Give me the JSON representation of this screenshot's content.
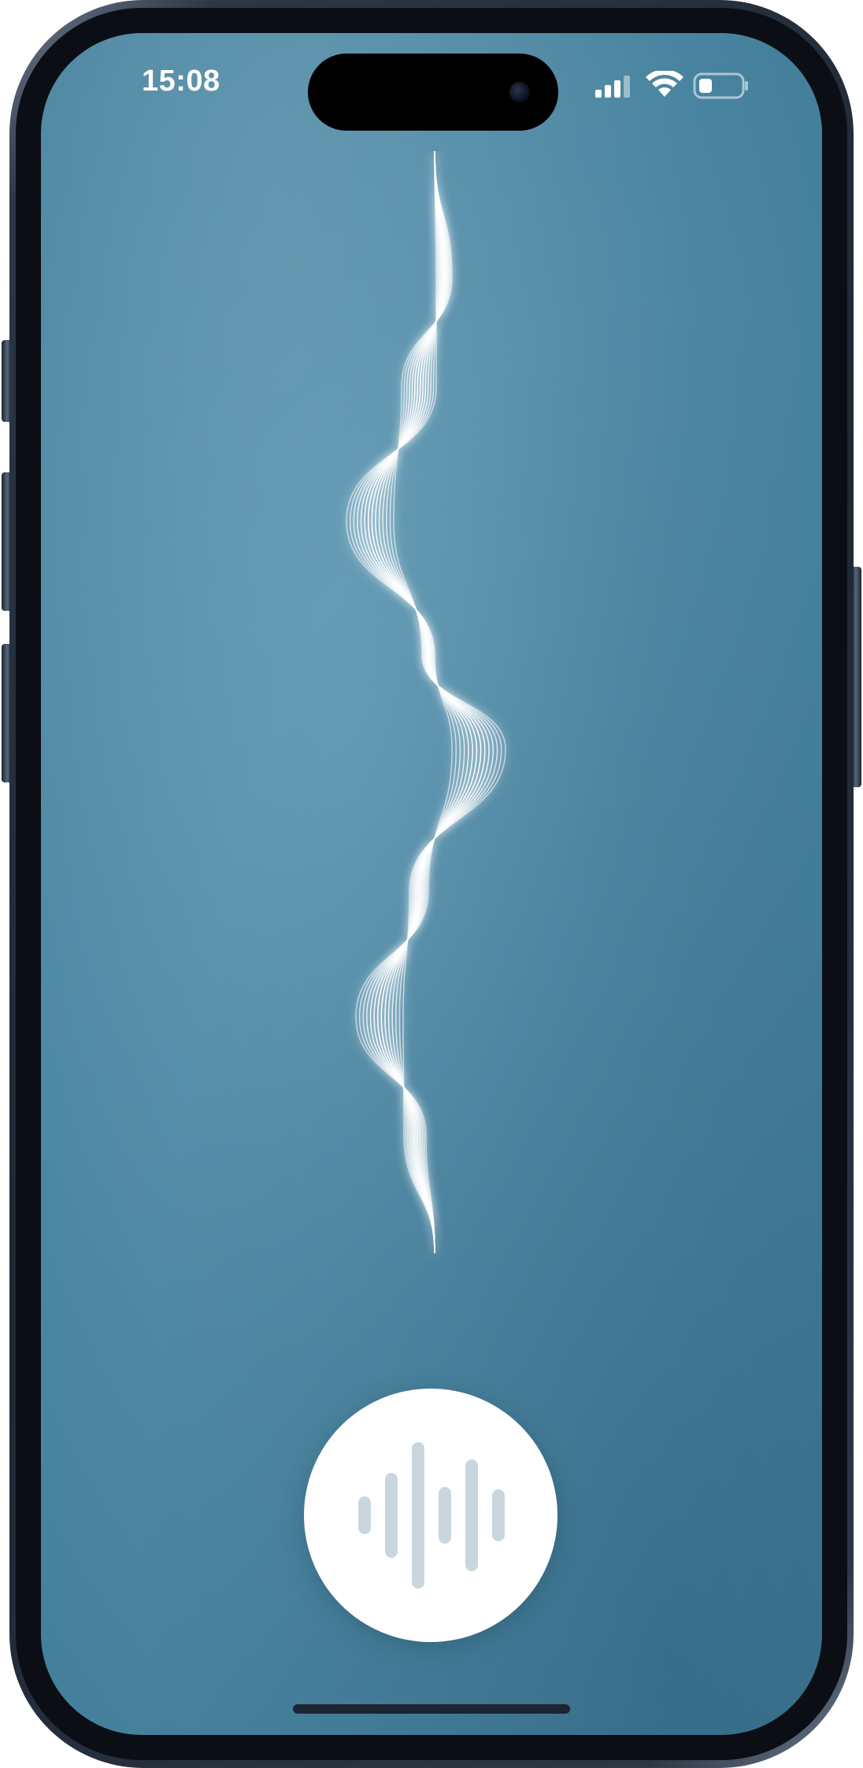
{
  "status_bar": {
    "time": "15:08",
    "signal_icon": "cellular-signal-icon",
    "wifi_icon": "wifi-icon",
    "battery_icon": "battery-low-icon"
  },
  "voice_wave": {
    "icon": "voice-waveform-animation",
    "color": "#ffffff"
  },
  "mic_button": {
    "icon": "audio-waveform-icon",
    "icon_color": "#c9d6de"
  },
  "colors": {
    "background": "#508aa5",
    "frame": "#1f2733"
  }
}
